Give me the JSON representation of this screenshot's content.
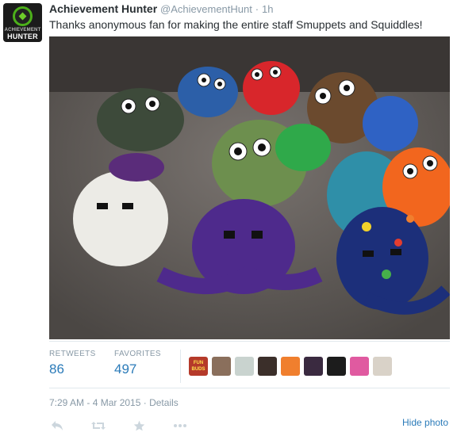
{
  "tweet": {
    "display_name": "Achievement Hunter",
    "handle": "@AchievementHunt",
    "separator": "·",
    "relative_time": "1h",
    "text": "Thanks anonymous fan for making the entire staff Smuppets and Squiddles!",
    "avatar": {
      "line1": "ACHIEVEMENT",
      "line2": "HUNTER"
    }
  },
  "stats": {
    "retweets_label": "RETWEETS",
    "retweets_count": "86",
    "favorites_label": "FAVORITES",
    "favorites_count": "497"
  },
  "favoriters": [
    {
      "name": "favoriter-1",
      "color": "#b53a2a",
      "text": "FUN BUDS"
    },
    {
      "name": "favoriter-2",
      "color": "#8a6f5c",
      "text": ""
    },
    {
      "name": "favoriter-3",
      "color": "#c9d3cf",
      "text": ""
    },
    {
      "name": "favoriter-4",
      "color": "#3b2f2a",
      "text": ""
    },
    {
      "name": "favoriter-5",
      "color": "#f07f2e",
      "text": ""
    },
    {
      "name": "favoriter-6",
      "color": "#3a2a40",
      "text": ""
    },
    {
      "name": "favoriter-7",
      "color": "#1c1c1c",
      "text": ""
    },
    {
      "name": "favoriter-8",
      "color": "#e05aa0",
      "text": ""
    },
    {
      "name": "favoriter-9",
      "color": "#d9d2c8",
      "text": ""
    }
  ],
  "meta": {
    "timestamp": "7:29 AM - 4 Mar 2015",
    "separator": "·",
    "details_link": "Details",
    "hide_photo": "Hide photo"
  },
  "actions": {
    "reply_icon": "reply-icon",
    "retweet_icon": "retweet-icon",
    "favorite_icon": "star-icon",
    "more_icon": "more-icon"
  }
}
